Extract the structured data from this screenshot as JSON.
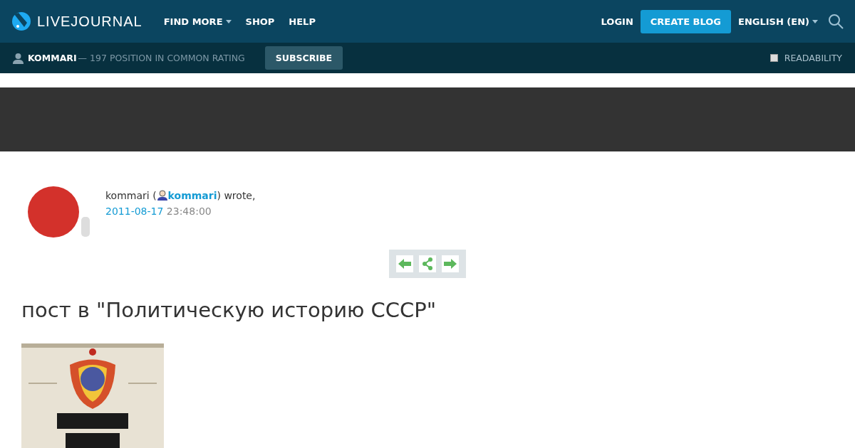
{
  "header": {
    "logo": "LIVEJOURNAL",
    "nav": [
      {
        "label": "FIND MORE",
        "dropdown": true
      },
      {
        "label": "SHOP",
        "dropdown": false
      },
      {
        "label": "HELP",
        "dropdown": false
      }
    ],
    "login": "LOGIN",
    "create_blog": "CREATE BLOG",
    "language": "ENGLISH (EN)"
  },
  "subbar": {
    "user": "KOMMARI",
    "rating": "— 197 POSITION IN COMMON RATING",
    "subscribe": "SUBSCRIBE",
    "readability": {
      "label": "READABILITY",
      "checked": false
    }
  },
  "post": {
    "author": "kommari",
    "open": " (",
    "user_link": "kommari",
    "wrote": ") wrote,",
    "date": "2011-08-17",
    "time": " 23:48:00",
    "title": "пост в \"Политическую историю СССР\""
  }
}
